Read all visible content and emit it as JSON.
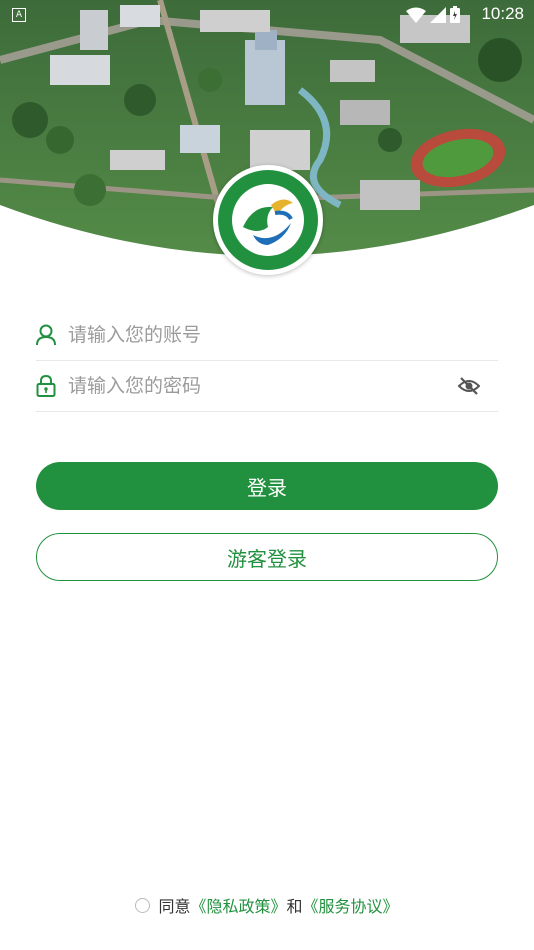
{
  "status_bar": {
    "time": "10:28",
    "app_badge": "A",
    "icons": [
      "wifi-icon",
      "signal-icon",
      "battery-icon"
    ]
  },
  "hero": {
    "image": "campus-aerial-illustration"
  },
  "logo": {
    "name": "college-emblem"
  },
  "form": {
    "account_placeholder": "请输入您的账号",
    "password_placeholder": "请输入您的密码",
    "account_icon": "user-icon",
    "password_icon": "lock-icon",
    "toggle_icon": "eye-off-icon"
  },
  "buttons": {
    "login": "登录",
    "guest_login": "游客登录"
  },
  "agreement": {
    "prefix": "同意",
    "privacy_link": "《隐私政策》",
    "and": "和",
    "service_link": "《服务协议》"
  },
  "colors": {
    "primary": "#22913f",
    "placeholder": "#9b9b9b"
  }
}
